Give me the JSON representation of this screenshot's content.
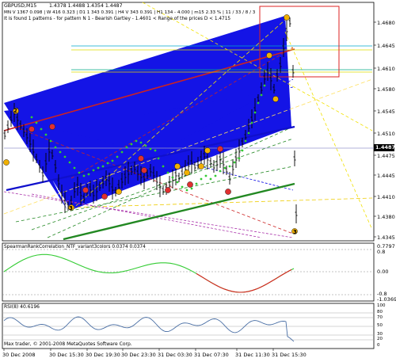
{
  "main_panel": {
    "symbol_tf": "GBPUSD,M15",
    "ohlc": "1.4378 1.4488 1.4354 1.4487",
    "indicator_line": "MN V 1367 0.098 | W 416 0.323 | D1 1 343 0.391 | H4 V 343 0.391 | H1 134 - 4.000 | m15 2.33 % | 11 / 33 / 8 / 3",
    "pattern_text": "It is found 1 patterns - for pattern N 1 - Bearish Gartley - 1.4601 < Range of the prices D < 1.4715",
    "price_ticks": [
      "1.4680",
      "1.4645",
      "1.4610",
      "1.4580",
      "1.4545",
      "1.4510",
      "1.4475",
      "1.4445",
      "1.4410",
      "1.4380",
      "1.4345"
    ],
    "current_price": "1.4487",
    "point_labels": [
      "2",
      "3",
      "3"
    ]
  },
  "sub_panel_1": {
    "title": "SpearmanRankCorrelation_NTF_variant3colors 0.0374 0.0374",
    "ticks": [
      "0.7797",
      "0.8",
      "0.00",
      "-0.8",
      "-1.0369"
    ]
  },
  "sub_panel_2": {
    "title": "RSI(8) 40.6196",
    "ticks": [
      "100",
      "80",
      "70",
      "50",
      "30",
      "20",
      "0"
    ],
    "copyright": "Max trader, © 2001-2008 MetaQuotes Software Corp."
  },
  "time_axis": {
    "labels": [
      "30 Dec 2008",
      "30 Dec 15:30",
      "30 Dec 19:30",
      "30 Dec 23:30",
      "31 Dec 03:30",
      "31 Dec 07:30",
      "31 Dec 11:30",
      "31 Dec 15:30"
    ]
  },
  "colors": {
    "wedge_blue": "#1010ee",
    "resistance_red": "#cc2222",
    "support_green": "#228822",
    "spearman_green": "#33cc33",
    "spearman_red": "#dd2222",
    "rsi_line": "#4a6fa5"
  }
}
